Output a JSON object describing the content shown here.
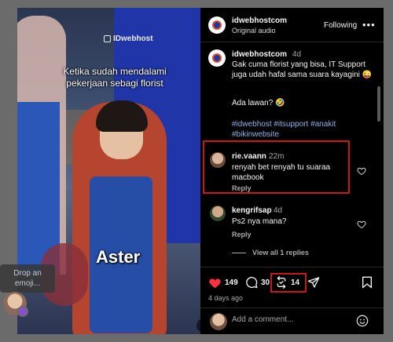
{
  "video": {
    "watermark": "IDwebhost",
    "caption": "Ketika sudah mendalami pekerjaan sebagi florist",
    "name_text": "Aster"
  },
  "drop_hint": "Drop an emoji...",
  "header": {
    "username": "idwebhostcom",
    "audio": "Original audio",
    "follow_label": "Following",
    "more_icon": "•••"
  },
  "caption": {
    "username": "idwebhostcom",
    "time": "4d",
    "text": "Gak cuma florist yang bisa, IT Support juga udah hafal sama suara kayagini 😜",
    "question": "Ada lawan? 🤣",
    "hashtags": "#idwebhost #itsupport #anakit #bikinwebsite"
  },
  "comments": [
    {
      "username": "rie.vaann",
      "time": "22m",
      "text": "renyah bet renyah tu suaraa macbook",
      "reply_label": "Reply"
    },
    {
      "username": "kengrifsap",
      "time": "4d",
      "text": "Ps2 nya mana?",
      "reply_label": "Reply",
      "view_replies": "View all 1 replies"
    }
  ],
  "actions": {
    "likes": "149",
    "comments": "30",
    "reposts": "14",
    "time_ago": "4 days ago"
  },
  "add_comment": {
    "placeholder": "Add a comment..."
  },
  "colors": {
    "highlight": "#c41a1a",
    "like": "#ff3040",
    "hashtag": "#8fb2e8"
  }
}
